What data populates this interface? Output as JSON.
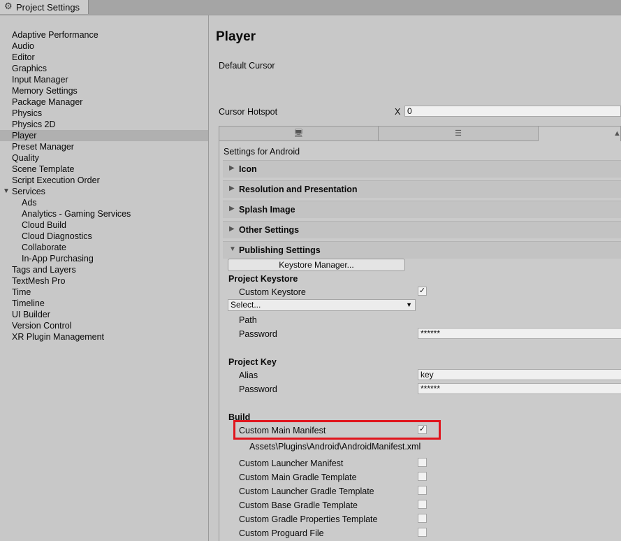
{
  "window": {
    "tab_title": "Project Settings",
    "tab_icon": "gear-icon"
  },
  "sidebar": {
    "items": [
      {
        "label": "Adaptive Performance"
      },
      {
        "label": "Audio"
      },
      {
        "label": "Editor"
      },
      {
        "label": "Graphics"
      },
      {
        "label": "Input Manager"
      },
      {
        "label": "Memory Settings"
      },
      {
        "label": "Package Manager"
      },
      {
        "label": "Physics"
      },
      {
        "label": "Physics 2D"
      },
      {
        "label": "Player",
        "selected": true
      },
      {
        "label": "Preset Manager"
      },
      {
        "label": "Quality"
      },
      {
        "label": "Scene Template"
      },
      {
        "label": "Script Execution Order"
      },
      {
        "label": "Services",
        "expanded": true
      },
      {
        "label": "Ads",
        "child": true
      },
      {
        "label": "Analytics - Gaming Services",
        "child": true
      },
      {
        "label": "Cloud Build",
        "child": true
      },
      {
        "label": "Cloud Diagnostics",
        "child": true
      },
      {
        "label": "Collaborate",
        "child": true
      },
      {
        "label": "In-App Purchasing",
        "child": true
      },
      {
        "label": "Tags and Layers"
      },
      {
        "label": "TextMesh Pro"
      },
      {
        "label": "Time"
      },
      {
        "label": "Timeline"
      },
      {
        "label": "UI Builder"
      },
      {
        "label": "Version Control"
      },
      {
        "label": "XR Plugin Management"
      }
    ]
  },
  "main": {
    "title": "Player",
    "default_cursor_label": "Default Cursor",
    "cursor_hotspot_label": "Cursor Hotspot",
    "hotspot_x_label": "X",
    "hotspot_x_value": "0",
    "platform_tabs": [
      {
        "icon": "monitor-icon",
        "glyph": "🖥"
      },
      {
        "icon": "server-icon",
        "glyph": "☰"
      },
      {
        "icon": "android-icon",
        "glyph": "▲",
        "active": true
      }
    ],
    "settings_for": "Settings for Android",
    "sections": [
      {
        "title": "Icon"
      },
      {
        "title": "Resolution and Presentation"
      },
      {
        "title": "Splash Image"
      },
      {
        "title": "Other Settings"
      },
      {
        "title": "Publishing Settings",
        "expanded": true
      }
    ],
    "publishing": {
      "keystore_manager_button": "Keystore Manager...",
      "project_keystore_heading": "Project Keystore",
      "custom_keystore_label": "Custom Keystore",
      "custom_keystore_checked": true,
      "keystore_select": "Select...",
      "path_label": "Path",
      "password_label": "Password",
      "password_value": "******",
      "project_key_heading": "Project Key",
      "alias_label": "Alias",
      "alias_value": "key",
      "key_password_label": "Password",
      "key_password_value": "******",
      "build_heading": "Build",
      "build_items": [
        {
          "label": "Custom Main Manifest",
          "checked": true
        },
        {
          "label": "Custom Launcher Manifest",
          "checked": false
        },
        {
          "label": "Custom Main Gradle Template",
          "checked": false
        },
        {
          "label": "Custom Launcher Gradle Template",
          "checked": false
        },
        {
          "label": "Custom Base Gradle Template",
          "checked": false
        },
        {
          "label": "Custom Gradle Properties Template",
          "checked": false
        },
        {
          "label": "Custom Proguard File",
          "checked": false
        }
      ],
      "manifest_path": "Assets\\Plugins\\Android\\AndroidManifest.xml"
    },
    "checkmark": "✓",
    "highlight_color": "#e0151d"
  }
}
